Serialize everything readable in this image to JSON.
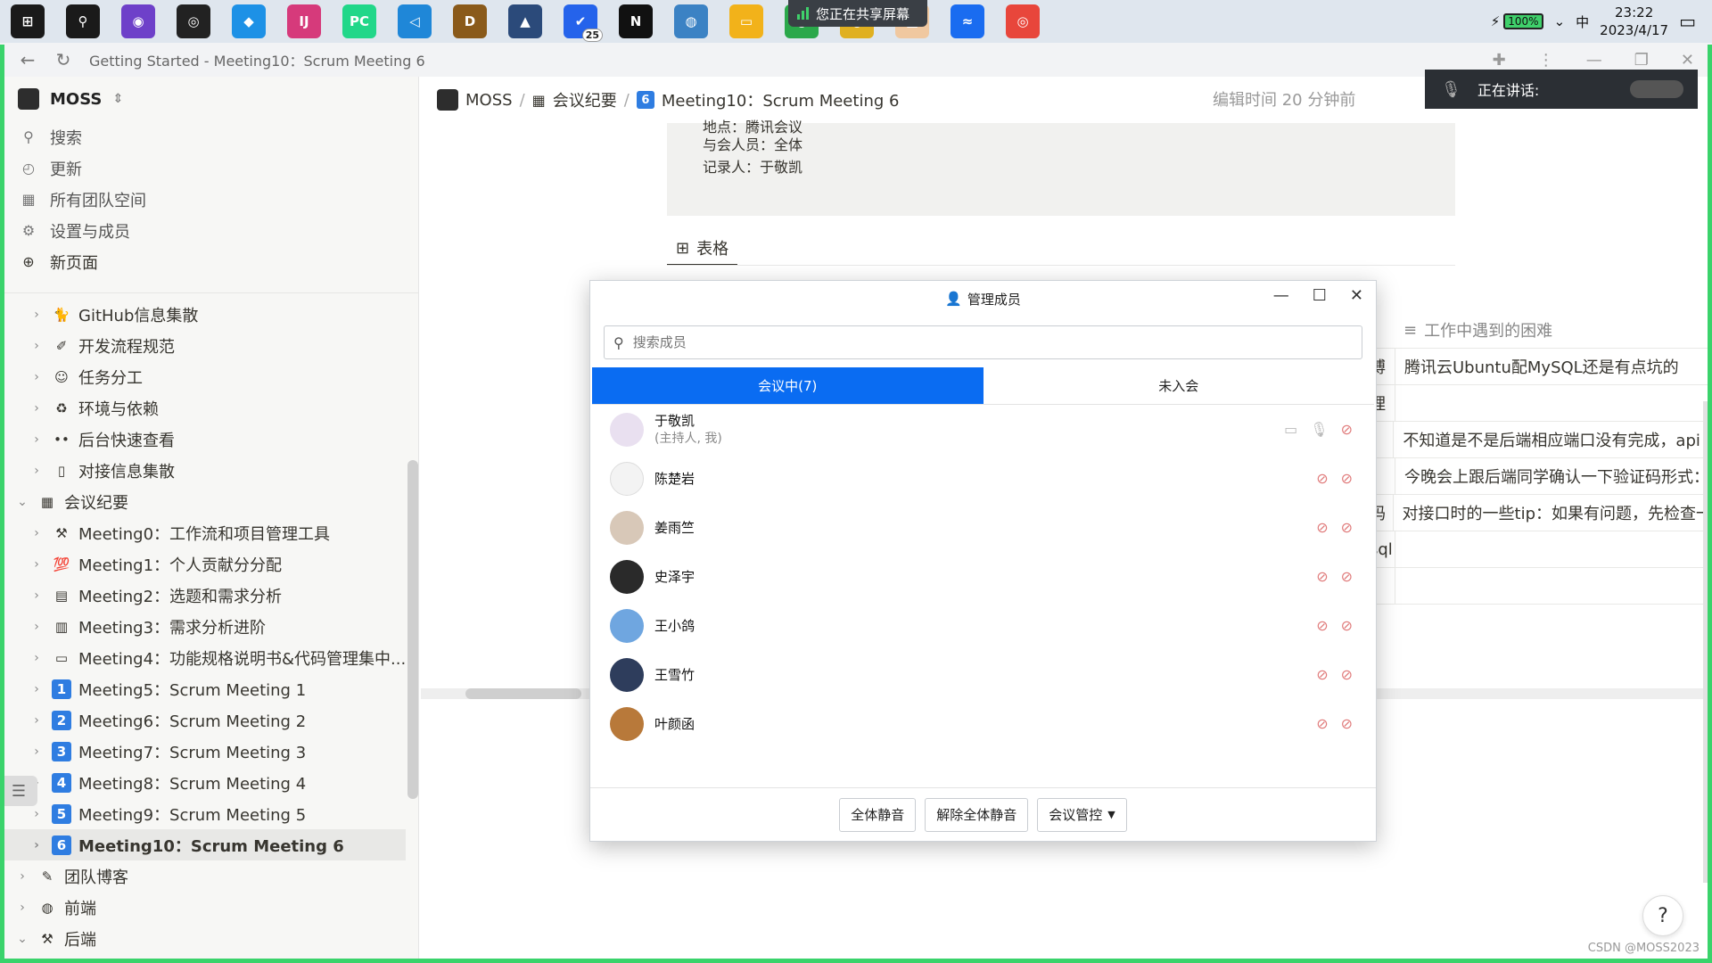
{
  "taskbar": {
    "share_banner": "您正在共享屏幕",
    "battery": "100%",
    "ime": "中",
    "time": "23:22",
    "date": "2023/4/17",
    "badge_count": "25",
    "apps": [
      {
        "name": "windows-start-icon",
        "color": "#1a1a1a",
        "glyph": "⊞"
      },
      {
        "name": "search-icon",
        "color": "#1a1a1a",
        "glyph": "⚲"
      },
      {
        "name": "github-desktop-icon",
        "color": "#6e40c9",
        "glyph": "◉"
      },
      {
        "name": "github-icon",
        "color": "#222222",
        "glyph": "◎"
      },
      {
        "name": "docker-icon",
        "color": "#1d91e6",
        "glyph": "◆"
      },
      {
        "name": "intellij-icon",
        "color": "#d63a7b",
        "glyph": "IJ"
      },
      {
        "name": "pycharm-icon",
        "color": "#21d789",
        "glyph": "PC"
      },
      {
        "name": "vscode-icon",
        "color": "#1f87d8",
        "glyph": "◁"
      },
      {
        "name": "dosbox-icon",
        "color": "#8a5a1a",
        "glyph": "D"
      },
      {
        "name": "cat-app-icon",
        "color": "#2b4a7a",
        "glyph": "▲"
      },
      {
        "name": "todo-icon",
        "color": "#2563eb",
        "glyph": "✔"
      },
      {
        "name": "notion-icon",
        "color": "#111111",
        "glyph": "N"
      },
      {
        "name": "network-icon",
        "color": "#3b82c4",
        "glyph": "◍"
      },
      {
        "name": "file-explorer-icon",
        "color": "#f2b21a",
        "glyph": "▭"
      },
      {
        "name": "chrome-icon",
        "color": "#2aa84a",
        "glyph": "●"
      },
      {
        "name": "chrome-dev-icon",
        "color": "#e0b020",
        "glyph": "●"
      },
      {
        "name": "whiteboard-icon",
        "color": "#f0c8a0",
        "glyph": "■"
      },
      {
        "name": "tencent-meeting-icon",
        "color": "#1a6cf0",
        "glyph": "≈"
      },
      {
        "name": "snail-icon",
        "color": "#e8463b",
        "glyph": "◎"
      }
    ]
  },
  "browser": {
    "title": "Getting Started - Meeting10：Scrum Meeting 6"
  },
  "sidebar": {
    "workspace": "MOSS",
    "actions": [
      {
        "label": "搜索",
        "icon": "search-icon",
        "glyph": "⚲"
      },
      {
        "label": "更新",
        "icon": "clock-icon",
        "glyph": "◴"
      },
      {
        "label": "所有团队空间",
        "icon": "building-icon",
        "glyph": "▦"
      },
      {
        "label": "设置与成员",
        "icon": "gear-icon",
        "glyph": "⚙"
      },
      {
        "label": "新页面",
        "icon": "plus-circle-icon",
        "glyph": "⊕"
      }
    ],
    "tree": [
      {
        "label": "GitHub信息集散",
        "level": 1,
        "chev": "›",
        "emoji": "🐈",
        "badge": false
      },
      {
        "label": "开发流程规范",
        "level": 1,
        "chev": "›",
        "emoji": "✐",
        "badge": false
      },
      {
        "label": "任务分工",
        "level": 1,
        "chev": "›",
        "emoji": "☺",
        "badge": false
      },
      {
        "label": "环境与依赖",
        "level": 1,
        "chev": "›",
        "emoji": "♻",
        "badge": false
      },
      {
        "label": "后台快速查看",
        "level": 1,
        "chev": "›",
        "emoji": "••",
        "badge": false
      },
      {
        "label": "对接信息集散",
        "level": 1,
        "chev": "›",
        "emoji": "▯",
        "badge": false
      },
      {
        "label": "会议纪要",
        "level": 0,
        "chev": "⌄",
        "emoji": "▦",
        "badge": false
      },
      {
        "label": "Meeting0：工作流和项目管理工具",
        "level": 1,
        "chev": "›",
        "emoji": "⚒",
        "badge": false
      },
      {
        "label": "Meeting1：个人贡献分分配",
        "level": 1,
        "chev": "›",
        "emoji": "💯",
        "badge": false
      },
      {
        "label": "Meeting2：选题和需求分析",
        "level": 1,
        "chev": "›",
        "emoji": "▤",
        "badge": false
      },
      {
        "label": "Meeting3：需求分析进阶",
        "level": 1,
        "chev": "›",
        "emoji": "▥",
        "badge": false
      },
      {
        "label": "Meeting4：功能规格说明书&代码管理集中...",
        "level": 1,
        "chev": "›",
        "emoji": "▭",
        "badge": false
      },
      {
        "label": "Meeting5：Scrum Meeting 1",
        "level": 1,
        "chev": "›",
        "emoji": "1",
        "badge": true
      },
      {
        "label": "Meeting6：Scrum Meeting 2",
        "level": 1,
        "chev": "›",
        "emoji": "2",
        "badge": true
      },
      {
        "label": "Meeting7：Scrum Meeting 3",
        "level": 1,
        "chev": "›",
        "emoji": "3",
        "badge": true
      },
      {
        "label": "Meeting8：Scrum Meeting 4",
        "level": 1,
        "chev": "›",
        "emoji": "4",
        "badge": true
      },
      {
        "label": "Meeting9：Scrum Meeting 5",
        "level": 1,
        "chev": "›",
        "emoji": "5",
        "badge": true
      },
      {
        "label": "Meeting10：Scrum Meeting 6",
        "level": 1,
        "chev": "›",
        "emoji": "6",
        "badge": true,
        "active": true
      },
      {
        "label": "团队博客",
        "level": 0,
        "chev": "›",
        "emoji": "✎",
        "badge": false
      },
      {
        "label": "前端",
        "level": 0,
        "chev": "›",
        "emoji": "◍",
        "badge": false
      },
      {
        "label": "后端",
        "level": 0,
        "chev": "⌄",
        "emoji": "⚒",
        "badge": false
      }
    ]
  },
  "breadcrumb": {
    "workspace": "MOSS",
    "section": "会议纪要",
    "page_badge": "6",
    "page": "Meeting10：Scrum Meeting 6"
  },
  "edit_time": "编辑时间 20 分钟前",
  "speaking": {
    "label": "正在讲话:"
  },
  "callout": {
    "partial_line": "地点：腾讯会议",
    "attendees": "与会人员：全体",
    "recorder": "记录人：于敬凯"
  },
  "table_tab": "表格",
  "bg_table": {
    "header": "工作中遇到的困难",
    "rows": [
      {
        "left": "搏",
        "right": "腾讯云Ubuntu配MySQL还是有点坑的"
      },
      {
        "left": "理",
        "right": ""
      },
      {
        "left": "",
        "right": "不知道是不是后端相应端口没有完成，api r"
      },
      {
        "left": "",
        "right": "今晚会上跟后端同学确认一下验证码形式："
      },
      {
        "left": "码",
        "right": "对接口时的一些tip：如果有问题，先检查一"
      },
      {
        "left": "sql",
        "right": ""
      },
      {
        "left": "",
        "right": ""
      }
    ]
  },
  "dialog": {
    "title": "管理成员",
    "search_placeholder": "搜索成员",
    "tab_in": "会议中(7)",
    "tab_out": "未入会",
    "members": [
      {
        "name": "于敬凯",
        "sub": "(主持人, 我)",
        "avatar": "#e9e0f0",
        "host": true
      },
      {
        "name": "陈楚岩",
        "sub": "",
        "avatar": "#f3f3f3",
        "host": false
      },
      {
        "name": "姜雨竺",
        "sub": "",
        "avatar": "#d8c8b8",
        "host": false
      },
      {
        "name": "史泽宇",
        "sub": "",
        "avatar": "#2a2a2a",
        "host": false
      },
      {
        "name": "王小鸽",
        "sub": "",
        "avatar": "#6fa6e0",
        "host": false
      },
      {
        "name": "王雪竹",
        "sub": "",
        "avatar": "#2e3d5c",
        "host": false
      },
      {
        "name": "叶颜函",
        "sub": "",
        "avatar": "#b8793a",
        "host": false
      }
    ],
    "btn_mute_all": "全体静音",
    "btn_unmute_all": "解除全体静音",
    "btn_control": "会议管控"
  },
  "watermark": "CSDN @MOSS2023",
  "help": "?"
}
